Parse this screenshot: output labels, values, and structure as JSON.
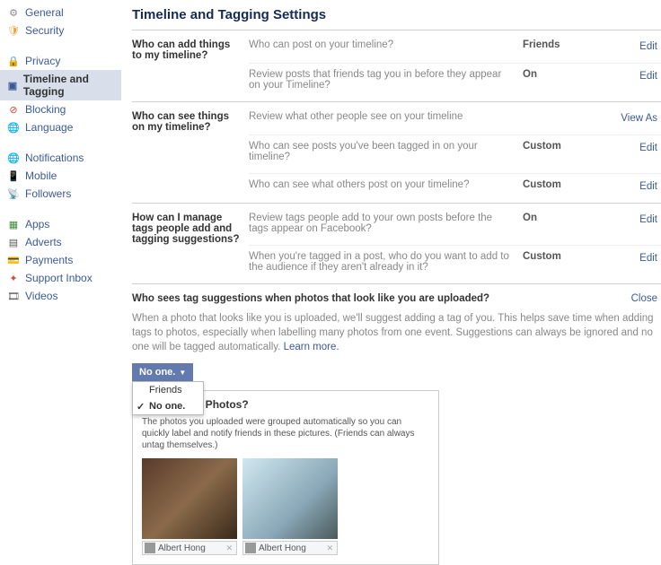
{
  "sidebar": {
    "groups": [
      [
        {
          "label": "General",
          "icon": "⚙",
          "color": "#888"
        },
        {
          "label": "Security",
          "icon": "🛡",
          "color": "#e8a33d"
        }
      ],
      [
        {
          "label": "Privacy",
          "icon": "🔒",
          "color": "#3b5998"
        },
        {
          "label": "Timeline and Tagging",
          "icon": "▣",
          "color": "#3b5998",
          "active": true
        },
        {
          "label": "Blocking",
          "icon": "⊘",
          "color": "#d14836"
        },
        {
          "label": "Language",
          "icon": "🌐",
          "color": "#555"
        }
      ],
      [
        {
          "label": "Notifications",
          "icon": "🌐",
          "color": "#555"
        },
        {
          "label": "Mobile",
          "icon": "📱",
          "color": "#555"
        },
        {
          "label": "Followers",
          "icon": "📡",
          "color": "#3b5998"
        }
      ],
      [
        {
          "label": "Apps",
          "icon": "▦",
          "color": "#3b8b3b"
        },
        {
          "label": "Adverts",
          "icon": "▤",
          "color": "#555"
        },
        {
          "label": "Payments",
          "icon": "💳",
          "color": "#555"
        },
        {
          "label": "Support Inbox",
          "icon": "✦",
          "color": "#d14836"
        },
        {
          "label": "Videos",
          "icon": "🎞",
          "color": "#555"
        }
      ]
    ]
  },
  "page": {
    "title": "Timeline and Tagging Settings"
  },
  "sections": [
    {
      "heading": "Who can add things to my timeline?",
      "rows": [
        {
          "q": "Who can post on your timeline?",
          "val": "Friends",
          "act": "Edit"
        },
        {
          "q": "Review posts that friends tag you in before they appear on your Timeline?",
          "val": "On",
          "act": "Edit"
        }
      ]
    },
    {
      "heading": "Who can see things on my timeline?",
      "rows": [
        {
          "q": "Review what other people see on your timeline",
          "val": "",
          "act": "View As"
        },
        {
          "q": "Who can see posts you've been tagged in on your timeline?",
          "val": "Custom",
          "act": "Edit"
        },
        {
          "q": "Who can see what others post on your timeline?",
          "val": "Custom",
          "act": "Edit"
        }
      ]
    },
    {
      "heading": "How can I manage tags people add and tagging suggestions?",
      "rows": [
        {
          "q": "Review tags people add to your own posts before the tags appear on Facebook?",
          "val": "On",
          "act": "Edit"
        },
        {
          "q": "When you're tagged in a post, who do you want to add to the audience if they aren't already in it?",
          "val": "Custom",
          "act": "Edit"
        }
      ]
    }
  ],
  "expanded": {
    "title": "Who sees tag suggestions when photos that look like you are uploaded?",
    "close": "Close",
    "desc": "When a photo that looks like you is uploaded, we'll suggest adding a tag of you. This helps save time when adding tags to photos, especially when labelling many photos from one event. Suggestions can always be ignored and no one will be tagged automatically. ",
    "learn": "Learn more.",
    "selected": "No one.",
    "options": [
      "Friends",
      "No one."
    ],
    "preview": {
      "heading": "hese Photos?",
      "sub": "The photos you uploaded were grouped automatically so you can quickly label and notify friends in these pictures. (Friends can always untag themselves.)",
      "photos": [
        {
          "name": "Albert Hong"
        },
        {
          "name": "Albert Hong"
        }
      ]
    }
  }
}
